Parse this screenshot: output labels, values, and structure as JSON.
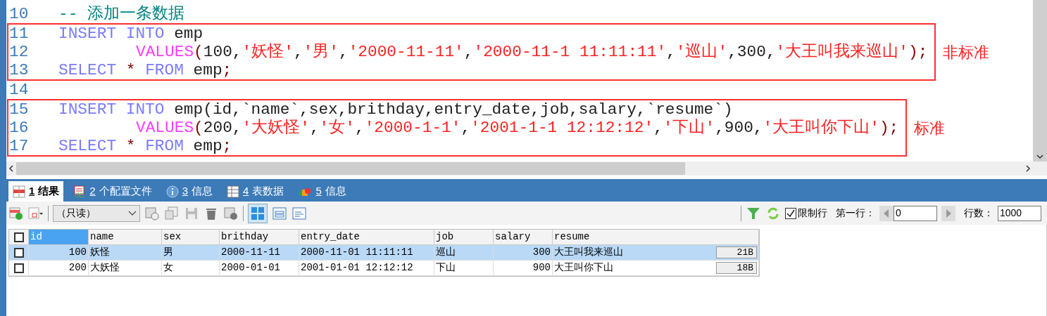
{
  "editor": {
    "blocks": [
      {
        "lines": [
          {
            "number": "10",
            "kind": "statement",
            "tokens": [
              {
                "kind": "comment",
                "text": "-- 添加一条数据"
              }
            ]
          }
        ]
      },
      {
        "annotation": "非标准",
        "lines": [
          {
            "number": "11",
            "kind": "statement",
            "tokens": [
              {
                "kind": "keyword",
                "text": "INSERT INTO "
              },
              {
                "kind": "plain",
                "text": "emp"
              }
            ]
          },
          {
            "number": "12",
            "kind": "continuation",
            "tokens": [
              {
                "kind": "function",
                "text": "VALUES"
              },
              {
                "kind": "punct",
                "text": "("
              },
              {
                "kind": "plain",
                "text": "100,"
              },
              {
                "kind": "string",
                "text": "'妖怪'"
              },
              {
                "kind": "plain",
                "text": ","
              },
              {
                "kind": "string",
                "text": "'男'"
              },
              {
                "kind": "plain",
                "text": ","
              },
              {
                "kind": "string",
                "text": "'2000-11-11'"
              },
              {
                "kind": "plain",
                "text": ","
              },
              {
                "kind": "string",
                "text": "'2000-11-1 11:11:11'"
              },
              {
                "kind": "plain",
                "text": ","
              },
              {
                "kind": "string",
                "text": "'巡山'"
              },
              {
                "kind": "plain",
                "text": ",300,"
              },
              {
                "kind": "string",
                "text": "'大王叫我来巡山'"
              },
              {
                "kind": "punct",
                "text": ");"
              }
            ]
          },
          {
            "number": "13",
            "kind": "statement",
            "tokens": [
              {
                "kind": "keyword",
                "text": "SELECT "
              },
              {
                "kind": "punct",
                "text": "* "
              },
              {
                "kind": "keyword",
                "text": "FROM "
              },
              {
                "kind": "plain",
                "text": "emp"
              },
              {
                "kind": "punct",
                "text": ";"
              }
            ]
          }
        ]
      },
      {
        "lines": [
          {
            "number": "14",
            "kind": "blank"
          }
        ]
      },
      {
        "annotation": "标准",
        "lines": [
          {
            "number": "15",
            "kind": "statement",
            "tokens": [
              {
                "kind": "keyword",
                "text": "INSERT INTO "
              },
              {
                "kind": "plain",
                "text": "emp(id,`name`,sex,brithday,entry_date,job,salary,`resume`)"
              }
            ]
          },
          {
            "number": "16",
            "kind": "continuation",
            "tokens": [
              {
                "kind": "function",
                "text": "VALUES"
              },
              {
                "kind": "punct",
                "text": "("
              },
              {
                "kind": "plain",
                "text": "200,"
              },
              {
                "kind": "string",
                "text": "'大妖怪'"
              },
              {
                "kind": "plain",
                "text": ","
              },
              {
                "kind": "string",
                "text": "'女'"
              },
              {
                "kind": "plain",
                "text": ","
              },
              {
                "kind": "string",
                "text": "'2000-1-1'"
              },
              {
                "kind": "plain",
                "text": ","
              },
              {
                "kind": "string",
                "text": "'2001-1-1 12:12:12'"
              },
              {
                "kind": "plain",
                "text": ","
              },
              {
                "kind": "string",
                "text": "'下山'"
              },
              {
                "kind": "plain",
                "text": ",900,"
              },
              {
                "kind": "string",
                "text": "'大王叫你下山'"
              },
              {
                "kind": "punct",
                "text": ");"
              }
            ]
          },
          {
            "number": "17",
            "kind": "statement",
            "tokens": [
              {
                "kind": "keyword",
                "text": "SELECT "
              },
              {
                "kind": "punct",
                "text": "* "
              },
              {
                "kind": "keyword",
                "text": "FROM "
              },
              {
                "kind": "plain",
                "text": "emp"
              },
              {
                "kind": "punct",
                "text": ";"
              }
            ]
          }
        ]
      }
    ]
  },
  "tabs": [
    {
      "kind": "grid",
      "number": "1",
      "label": "结果",
      "selected": true
    },
    {
      "kind": "profile",
      "number": "2",
      "label": "个配置文件",
      "selected": false
    },
    {
      "kind": "info",
      "number": "3",
      "label": "信息",
      "selected": false
    },
    {
      "kind": "table",
      "number": "4",
      "label": "表数据",
      "selected": false
    },
    {
      "kind": "blocks",
      "number": "5",
      "label": "信息",
      "selected": false
    }
  ],
  "toolbar": {
    "mode": "（只读）",
    "limit_rows": {
      "label": "限制行",
      "checked": true
    },
    "first_row": {
      "label": "第一行：",
      "value": "0"
    },
    "row_count": {
      "label": "行数：",
      "value": "1000"
    }
  },
  "grid": {
    "all_checked": false,
    "columns": [
      {
        "name": "id",
        "selected": true
      },
      {
        "name": "name",
        "selected": false
      },
      {
        "name": "sex",
        "selected": false
      },
      {
        "name": "brithday",
        "selected": false
      },
      {
        "name": "entry_date",
        "selected": false
      },
      {
        "name": "job",
        "selected": false
      },
      {
        "name": "salary",
        "selected": false
      },
      {
        "name": "resume",
        "selected": false
      }
    ],
    "rows": [
      {
        "selected": true,
        "checked": false,
        "cells": [
          "100",
          "妖怪",
          "男",
          "2000-11-11",
          "2000-11-01 11:11:11",
          "巡山",
          "300",
          "大王叫我来巡山"
        ],
        "size": "21B"
      },
      {
        "selected": false,
        "checked": false,
        "cells": [
          "200",
          "大妖怪",
          "女",
          "2000-01-01",
          "2001-01-01 12:12:12",
          "下山",
          "900",
          "大王叫你下山"
        ],
        "size": "18B"
      }
    ]
  }
}
